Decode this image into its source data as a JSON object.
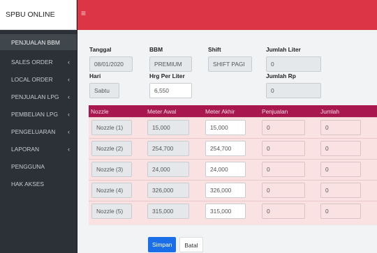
{
  "app": {
    "title": "SPBU ONLINE"
  },
  "sidebar": {
    "items": [
      {
        "label": "PENJUALAN BBM",
        "has_children": false,
        "active": true
      },
      {
        "label": "SALES ORDER",
        "has_children": true
      },
      {
        "label": "LOCAL ORDER",
        "has_children": true
      },
      {
        "label": "PENJUALAN LPG",
        "has_children": true
      },
      {
        "label": "PEMBELIAN LPG",
        "has_children": true
      },
      {
        "label": "PENGELUARAN",
        "has_children": true
      },
      {
        "label": "LAPORAN",
        "has_children": true
      },
      {
        "label": "PENGGUNA",
        "has_children": false
      },
      {
        "label": "HAK AKSES",
        "has_children": false
      }
    ],
    "chevron": "‹"
  },
  "topbar": {
    "menu_icon": "≡"
  },
  "form": {
    "tanggal": {
      "label": "Tanggal",
      "value": "08/01/2020"
    },
    "bbm": {
      "label": "BBM",
      "value": "PREMIUM"
    },
    "shift": {
      "label": "Shift",
      "value": "SHIFT PAGI"
    },
    "jumlah_liter": {
      "label": "Jumlah Liter",
      "value": "0"
    },
    "hari": {
      "label": "Hari",
      "value": "Sabtu"
    },
    "hrg_per_liter": {
      "label": "Hrg Per Liter",
      "value": "6,550"
    },
    "jumlah_rp": {
      "label": "Jumlah Rp",
      "value": "0"
    }
  },
  "grid": {
    "headers": [
      "Nozzle",
      "Meter Awal",
      "Meter Akhir",
      "Penjualan",
      "Jumlah"
    ],
    "rows": [
      {
        "nozzle": "Nozzle (1)",
        "meter_awal": "15,000",
        "meter_akhir": "15,000",
        "penjualan": "0",
        "jumlah": "0"
      },
      {
        "nozzle": "Nozzle (2)",
        "meter_awal": "254,700",
        "meter_akhir": "254,700",
        "penjualan": "0",
        "jumlah": "0"
      },
      {
        "nozzle": "Nozzle (3)",
        "meter_awal": "24,000",
        "meter_akhir": "24,000",
        "penjualan": "0",
        "jumlah": "0"
      },
      {
        "nozzle": "Nozzle (4)",
        "meter_awal": "326,000",
        "meter_akhir": "326,000",
        "penjualan": "0",
        "jumlah": "0"
      },
      {
        "nozzle": "Nozzle (5)",
        "meter_awal": "315,000",
        "meter_akhir": "315,000",
        "penjualan": "0",
        "jumlah": "0"
      }
    ]
  },
  "buttons": {
    "save": "Simpan",
    "cancel": "Batal"
  },
  "colors": {
    "accent_red": "#dc3545",
    "grid_header": "#a8184f",
    "primary_blue": "#1a6fe8"
  }
}
